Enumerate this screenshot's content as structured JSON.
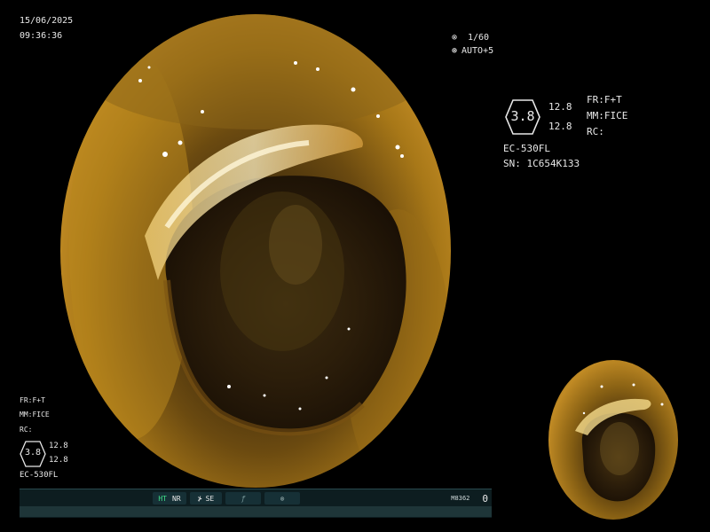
{
  "header": {
    "date": "15/06/2025",
    "time": "09:36:36"
  },
  "shutter": {
    "speed": "1/60",
    "auto": "AUTO+5"
  },
  "info_panel": {
    "hex_value": "3.8",
    "top_value": "12.8",
    "bottom_value": "12.8",
    "fr": "FR:F+T",
    "mm": "MM:FICE",
    "rc": "RC:",
    "scope_model": "EC-530FL",
    "serial": "SN: 1C654K133"
  },
  "bottom_left_panel": {
    "fr": "FR:F+T",
    "mm": "MM:FICE",
    "rc": "RC:",
    "hex_value": "3.8",
    "top_value": "12.8",
    "bottom_value": "12.8",
    "scope_model": "EC-530FL"
  },
  "status_bar": {
    "ht": "HT",
    "nr": "NR",
    "se": "SE",
    "code": "M8362",
    "count": "0"
  },
  "colors": {
    "accent_green": "#3fe08a",
    "bar_bg": "#0d1d20"
  }
}
